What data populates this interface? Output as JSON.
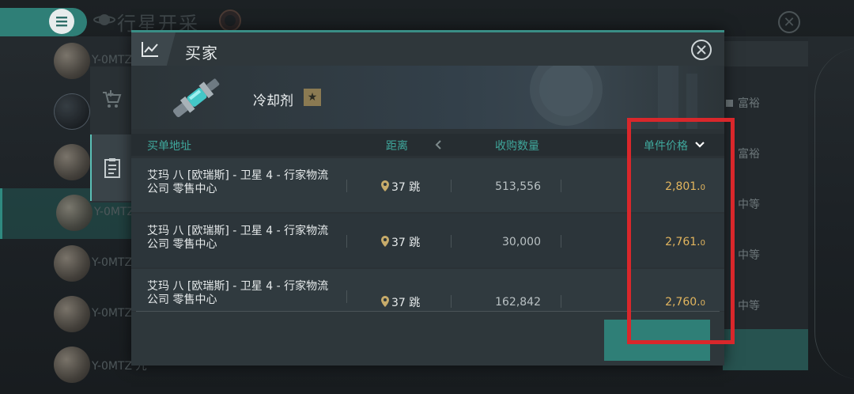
{
  "background": {
    "title": "行星开采",
    "planets": [
      {
        "label": "Y-0MTZ"
      },
      {
        "label": ""
      },
      {
        "label": ""
      },
      {
        "label": "Y-0MTZ"
      },
      {
        "label": "Y-0MTZ"
      },
      {
        "label": "Y-0MTZ"
      },
      {
        "label": "Y-0MTZ 九"
      }
    ],
    "right_panel": [
      "富裕",
      "富裕",
      "中等",
      "中等",
      "中等"
    ]
  },
  "dialog": {
    "title": "买家",
    "item": {
      "name": "冷却剂",
      "badge": "★"
    },
    "columns": {
      "address": "买单地址",
      "distance": "距离",
      "quantity": "收购数量",
      "unit_price": "单件价格"
    },
    "rows": [
      {
        "address": "艾玛 八 [欧瑞斯] - 卫星 4 - 行家物流公司 零售中心",
        "jumps": "37 跳",
        "quantity": "513,556",
        "price_main": "2,801.",
        "price_dec": "0"
      },
      {
        "address": "艾玛 八 [欧瑞斯] - 卫星 4 - 行家物流公司 零售中心",
        "jumps": "37 跳",
        "quantity": "30,000",
        "price_main": "2,761.",
        "price_dec": "0"
      },
      {
        "address": "艾玛 八 [欧瑞斯] - 卫星 4 - 行家物流公司 零售中心",
        "jumps": "37 跳",
        "quantity": "162,842",
        "price_main": "2,760.",
        "price_dec": "0"
      }
    ]
  },
  "colors": {
    "accent": "#2f7f77",
    "price": "#e2b55e",
    "highlight": "#d9272b"
  }
}
